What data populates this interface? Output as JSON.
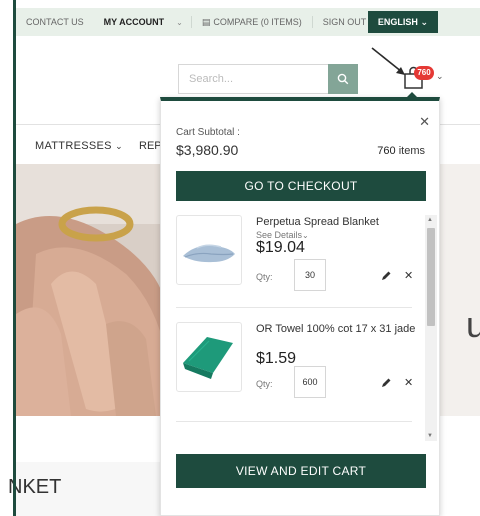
{
  "topbar": {
    "contact": "CONTACT US",
    "account": "MY ACCOUNT",
    "compare": "COMPARE (0 ITEMS)",
    "signout": "SIGN OUT",
    "language": "ENGLISH"
  },
  "search": {
    "placeholder": "Search..."
  },
  "cart": {
    "badge": "760"
  },
  "nav": {
    "mattresses": "MATTRESSES",
    "partial": "REP"
  },
  "hero": {
    "partial_text": "uct"
  },
  "bottom": {
    "heading": "NKET"
  },
  "minicart": {
    "subtotal_label": "Cart Subtotal :",
    "subtotal": "$3,980.90",
    "count": "760",
    "count_suffix": "items",
    "checkout_label": "GO TO CHECKOUT",
    "view_cart_label": "VIEW AND EDIT CART",
    "items": [
      {
        "name": "Perpetua Spread Blanket",
        "details": "See Details",
        "price": "$19.04",
        "qty_label": "Qty:",
        "qty": "30",
        "thumb_color": "#a9bfd6"
      },
      {
        "name": "OR Towel 100% cot 17 x 31 jade",
        "price": "$1.59",
        "qty_label": "Qty:",
        "qty": "600",
        "thumb_color": "#1e9a7a"
      }
    ]
  },
  "colors": {
    "brand_green": "#1e4b3e",
    "topbar_bg": "#e8f0e9",
    "search_button": "#83a597",
    "badge_red": "#e53935"
  }
}
